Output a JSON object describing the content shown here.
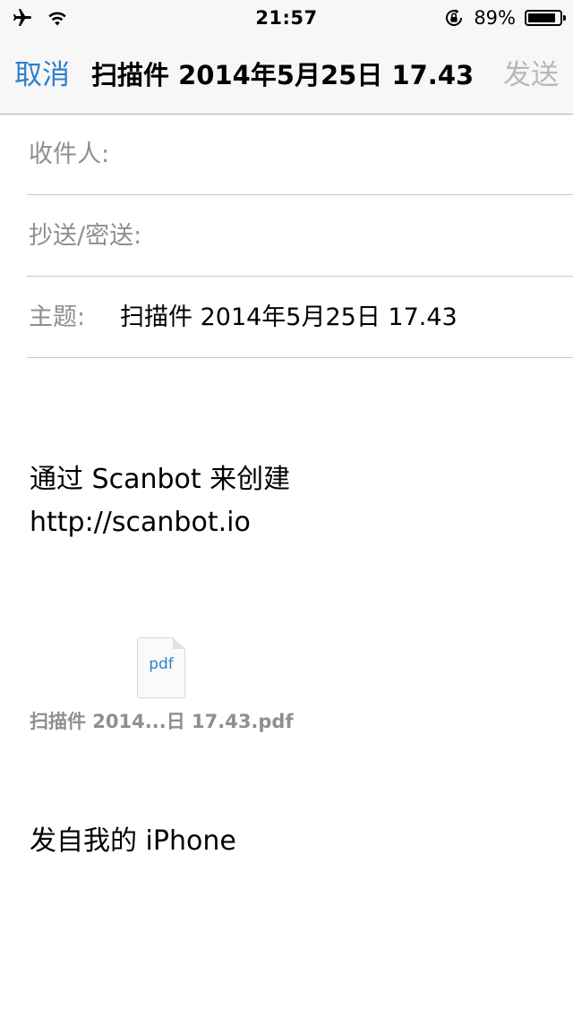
{
  "status_bar": {
    "time": "21:57",
    "battery_percent": "89%",
    "battery_level": 0.89,
    "icons": [
      "airplane-icon",
      "wifi-icon",
      "orientation-lock-icon",
      "battery-icon"
    ]
  },
  "nav": {
    "cancel_label": "取消",
    "title": "扫描件 2014年5月25日 17.43",
    "send_label": "发送"
  },
  "fields": {
    "to_label": "收件人:",
    "cc_bcc_label": "抄送/密送:",
    "subject_label": "主题:",
    "subject_value": "扫描件 2014年5月25日 17.43"
  },
  "body": {
    "line1": "通过 Scanbot 来创建",
    "line2": "http://scanbot.io",
    "signature": "发自我的 iPhone"
  },
  "attachment": {
    "ext": "pdf",
    "name": "扫描件 2014...日 17.43.pdf"
  },
  "colors": {
    "accent": "#2f80cf",
    "disabled": "#b8b8b8",
    "label_gray": "#8e8e93",
    "bar_background": "#f7f7f7"
  }
}
